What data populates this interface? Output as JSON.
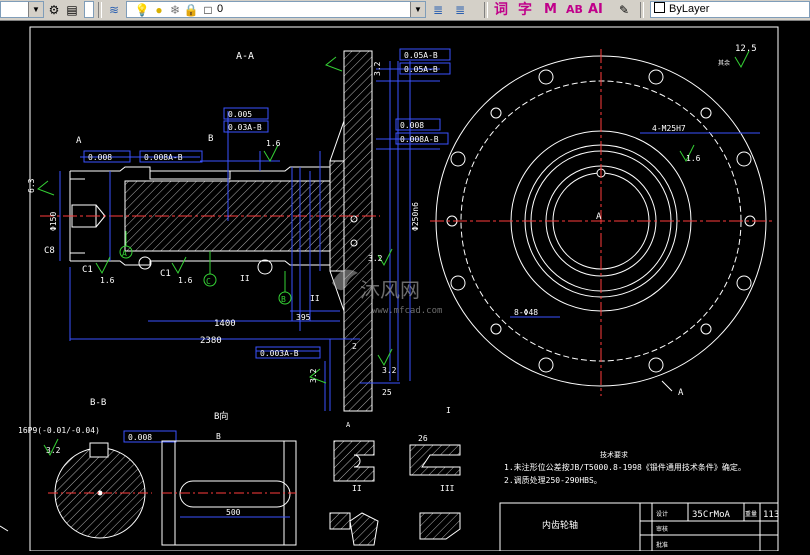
{
  "toolbar": {
    "layer_value": "0",
    "linetype_value": "ByLayer",
    "text_style_icon": "词",
    "dim_style_icon": "字",
    "text_m_icon": "M",
    "text_ab_icon": "AB",
    "text_ai_icon": "AI",
    "icons": [
      "layer-manager-icon",
      "bulb-icon",
      "sun-icon",
      "freeze-icon",
      "lock-icon",
      "color-square-icon",
      "match-layer-icon",
      "layer-previous-icon"
    ]
  },
  "drawing": {
    "section_a": "A-A",
    "section_bb": "B-B",
    "view_b": "B向",
    "label_a": "A",
    "label_b": "B",
    "label_c": "C",
    "label_c1a": "C1",
    "label_c1b": "C1",
    "label_c8": "C8",
    "label_i": "I",
    "label_ii": "II",
    "label_iii": "III",
    "rough_16a": "1.6",
    "rough_16b": "1.6",
    "rough_16c": "1.6",
    "rough_16d": "1.6",
    "rough_32a": "3.2",
    "rough_32b": "3.2",
    "rough_32c": "3.2",
    "rough_32d": "3.2",
    "rough_63": "6.3",
    "rough_125": "12.5",
    "rough_remain": "其余",
    "dim_1400": "1400",
    "dim_2380": "2380",
    "dim_395": "395",
    "dim_25": "25",
    "dim_2": "2",
    "dim_500": "500",
    "dim_26": "26",
    "holes_4": "4-M25H7",
    "holes_8": "8-Φ48",
    "tol_1": "0.008",
    "tol_2": "0.008A-B",
    "tol_3": "0.03A-B",
    "tol_4": "0.05A-B",
    "tol_5": "0.008",
    "tol_6": "0.05A-B",
    "tol_7": "0.008A-B",
    "tol_8": "0.003A-B",
    "tol_9": "0.005",
    "keyway": "16P9(-0.01/-0.04)",
    "dia_left": "Φ150",
    "dia_mid": "Φ250n6",
    "tech_title": "技术要求",
    "tech_1": "1.未注形位公差按JB/T5000.8-1998《锻件通用技术条件》确定。",
    "tech_2": "2.调质处理250-290HBS。",
    "part_name": "内齿轮轴",
    "material": "35CrMoA",
    "weight_label": "重量",
    "weight_value": "113",
    "drawn_by": "设计",
    "checked_by": "审核",
    "approved": "批准",
    "watermark_main": "沐风网",
    "watermark_url": "www.mfcad.com"
  },
  "colors": {
    "line": "#ffffff",
    "dimension": "#3a52ff",
    "hatch": "#ffffff",
    "rough": "#35d235",
    "center": "#ff3b3b",
    "text_yellow": "#ffffff",
    "toolbar_bg": "#d4d0c8"
  }
}
